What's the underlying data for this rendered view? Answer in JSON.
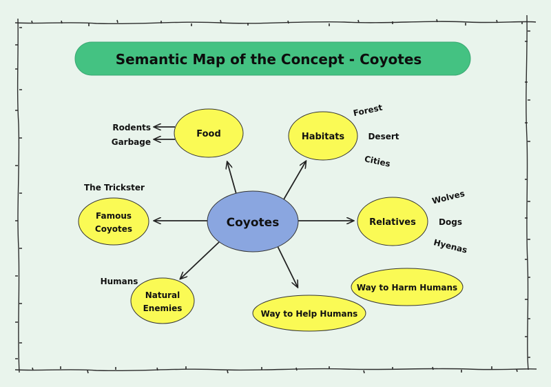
{
  "title": "Semantic Map of the Concept - Coyotes",
  "colors": {
    "background": "#e9f4ec",
    "title_fill": "#44c282",
    "center_fill": "#8aa6e0",
    "node_fill": "#fafa55",
    "stroke": "#222222",
    "border": "#2a2a2a"
  },
  "center": {
    "label": "Coyotes"
  },
  "nodes": {
    "food": {
      "label": "Food",
      "details": [
        "Rodents",
        "Garbage"
      ]
    },
    "habitats": {
      "label": "Habitats",
      "details": [
        "Forest",
        "Desert",
        "Cities"
      ]
    },
    "relatives": {
      "label": "Relatives",
      "details": [
        "Wolves",
        "Dogs",
        "Hyenas"
      ]
    },
    "famous": {
      "label_lines": [
        "Famous",
        "Coyotes"
      ],
      "details": [
        "The Trickster"
      ]
    },
    "enemies": {
      "label_lines": [
        "Natural",
        "Enemies"
      ],
      "details": [
        "Humans"
      ]
    },
    "help": {
      "label": "Way to Help Humans"
    },
    "harm": {
      "label": "Way to Harm Humans"
    }
  }
}
